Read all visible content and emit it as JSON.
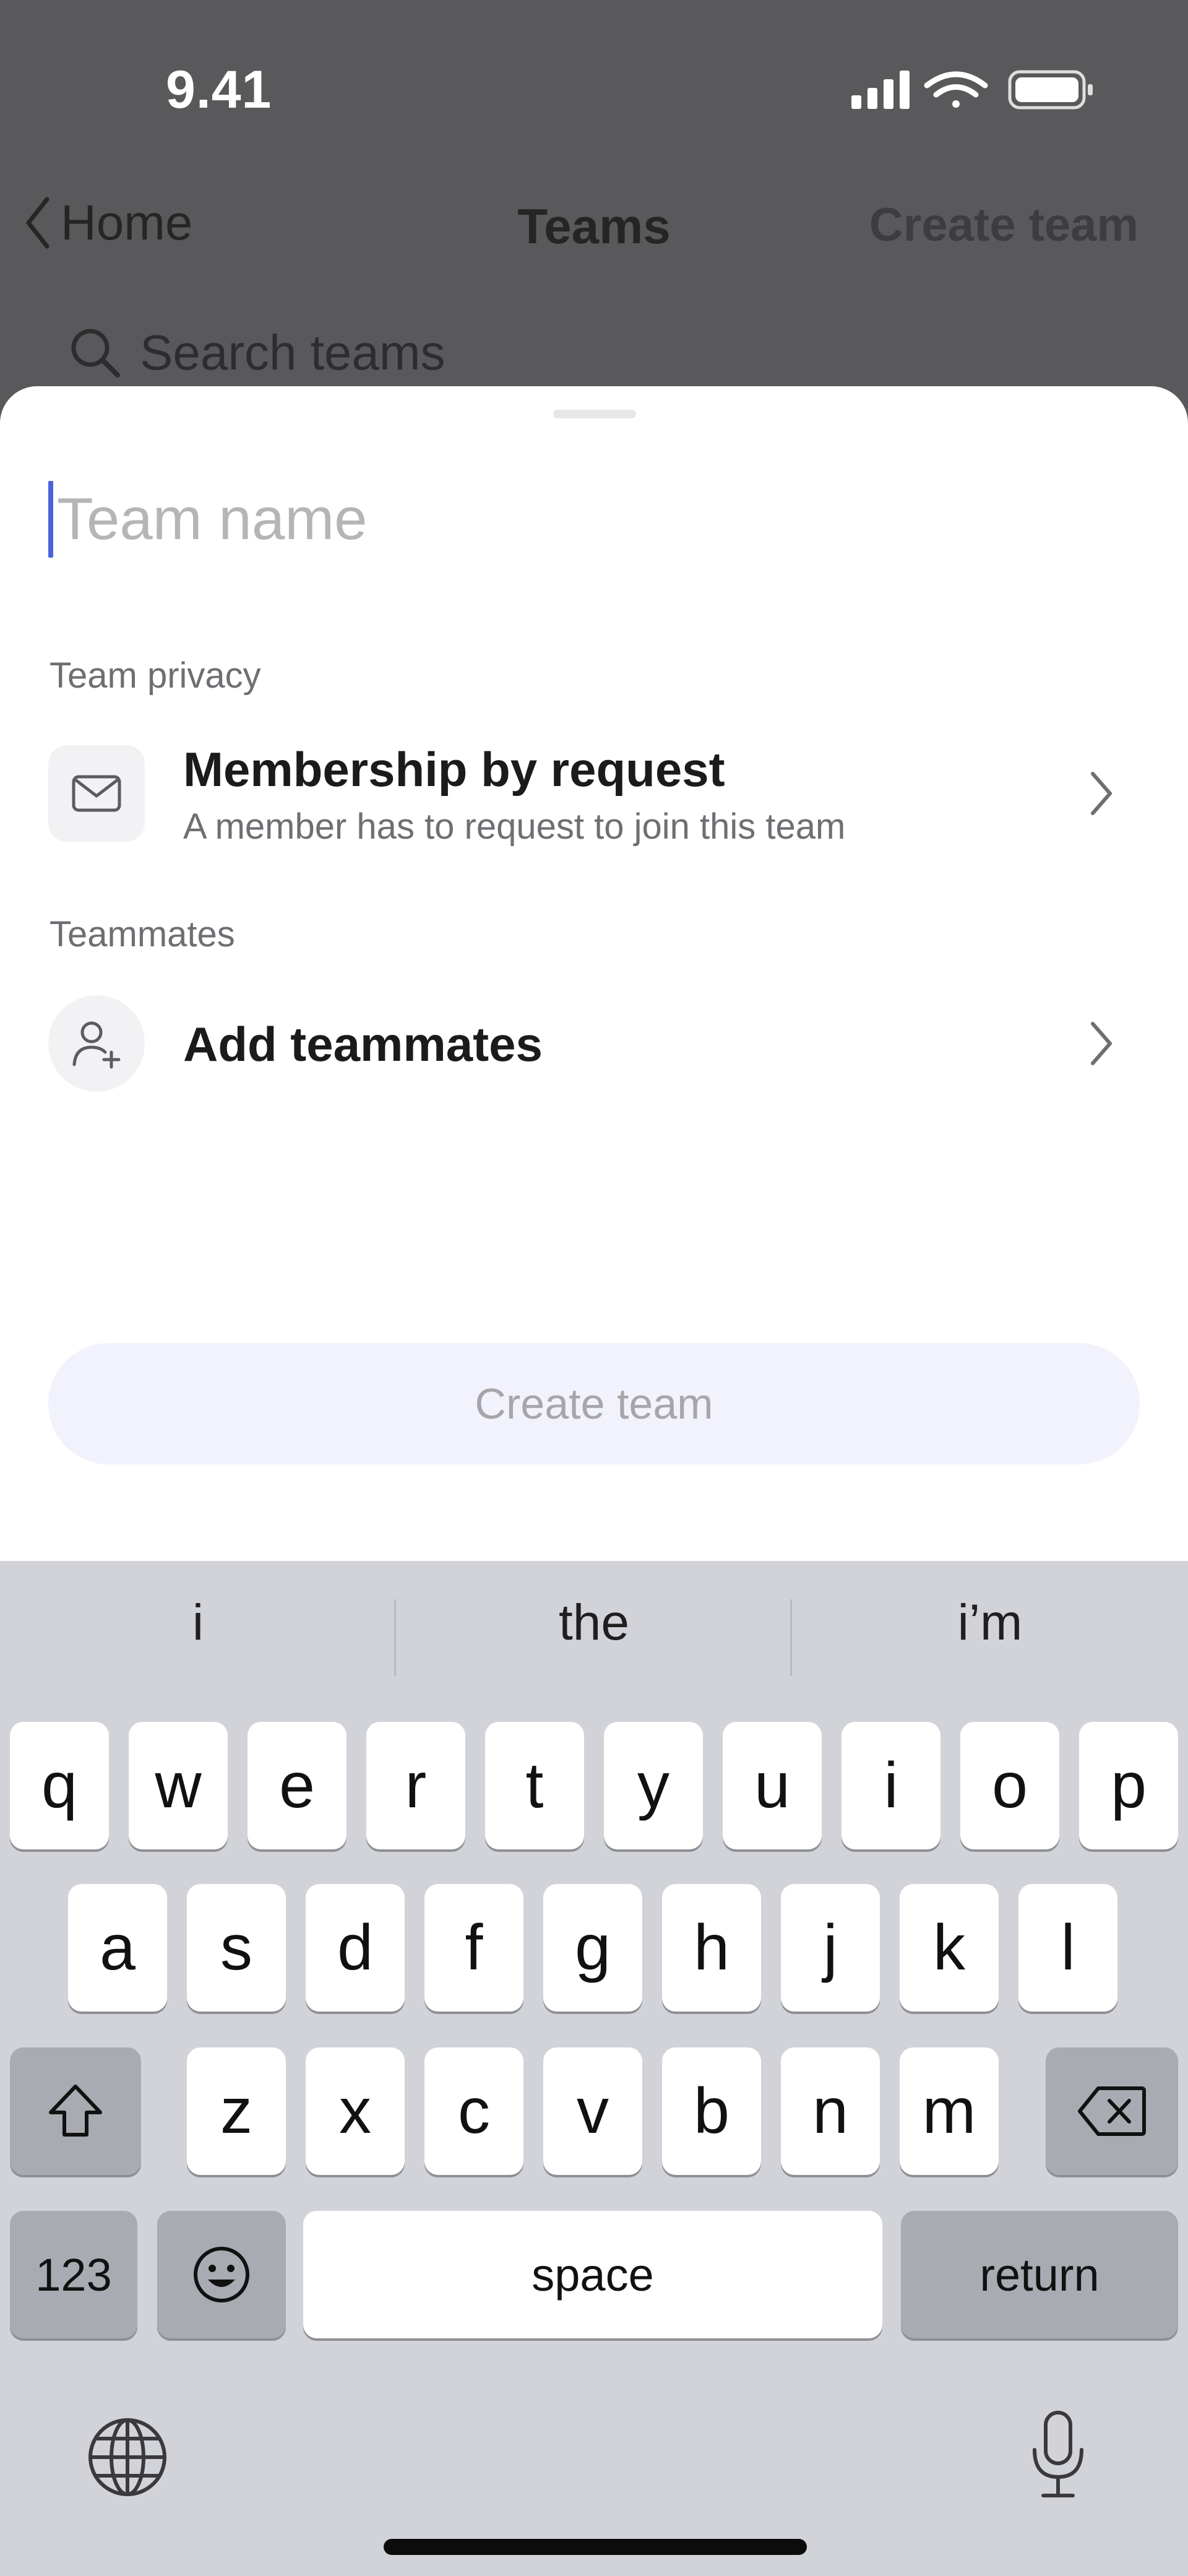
{
  "status_bar": {
    "time": "9.41"
  },
  "nav": {
    "back_label": "Home",
    "title": "Teams",
    "action_label": "Create team"
  },
  "search": {
    "placeholder": "Search teams"
  },
  "sheet": {
    "name_placeholder": "Team name",
    "privacy_section_label": "Team privacy",
    "privacy_title": "Membership by request",
    "privacy_subtitle": "A member has to request to join this team",
    "teammates_section_label": "Teammates",
    "add_teammates_label": "Add teammates",
    "create_button_label": "Create team"
  },
  "keyboard": {
    "suggestions": [
      "i",
      "the",
      "i’m"
    ],
    "row1": [
      "q",
      "w",
      "e",
      "r",
      "t",
      "y",
      "u",
      "i",
      "o",
      "p"
    ],
    "row2": [
      "a",
      "s",
      "d",
      "f",
      "g",
      "h",
      "j",
      "k",
      "l"
    ],
    "row3": [
      "z",
      "x",
      "c",
      "v",
      "b",
      "n",
      "m"
    ],
    "numbers_label": "123",
    "space_label": "space",
    "return_label": "return"
  },
  "icons": {
    "privacy": "envelope-icon",
    "teammates": "add-person-icon",
    "globe": "globe-icon",
    "mic": "microphone-icon"
  },
  "colors": {
    "caret": "#4a63d9",
    "create_button_bg": "#f1f2fb",
    "keyboard_bg": "#d1d3d9"
  }
}
